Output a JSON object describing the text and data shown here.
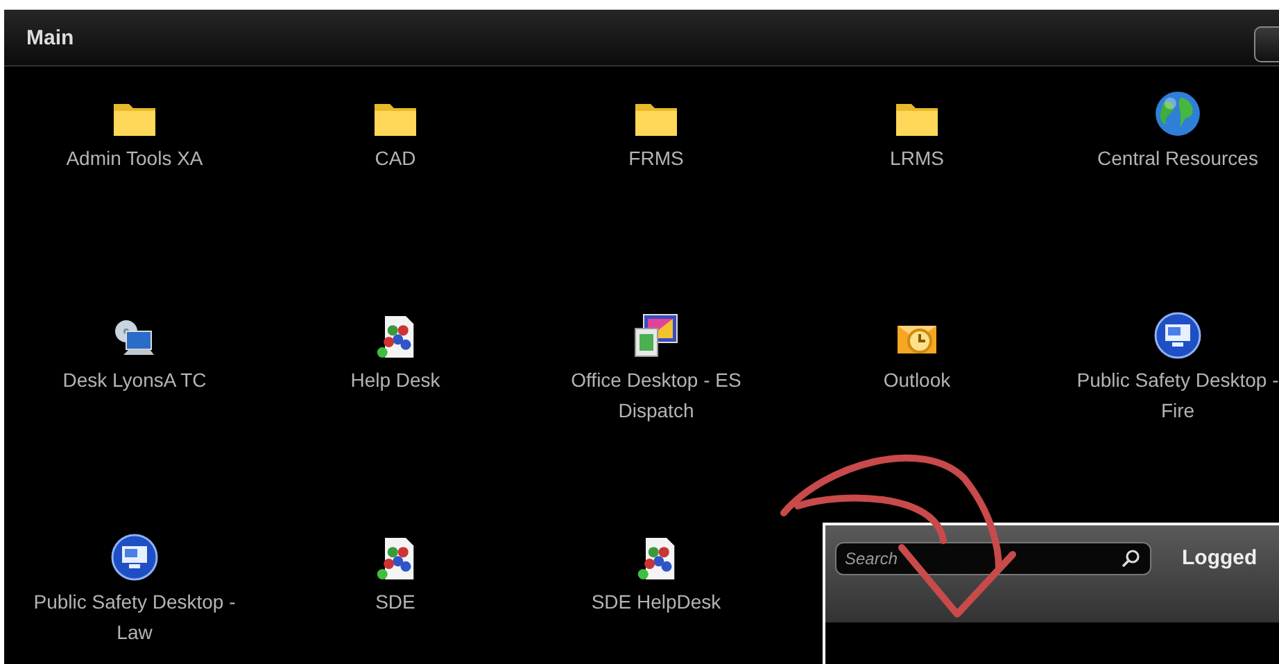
{
  "panel": {
    "title": "Main"
  },
  "items": [
    {
      "label": "Admin Tools XA",
      "kind": "folder"
    },
    {
      "label": "CAD",
      "kind": "folder"
    },
    {
      "label": "FRMS",
      "kind": "folder"
    },
    {
      "label": "LRMS",
      "kind": "folder"
    },
    {
      "label": "Central Resources",
      "kind": "globe"
    },
    {
      "label": "Desk LyonsA TC",
      "kind": "computer"
    },
    {
      "label": "Help Desk",
      "kind": "document"
    },
    {
      "label": "Office Desktop - ES Dispatch",
      "kind": "office"
    },
    {
      "label": "Outlook",
      "kind": "mail"
    },
    {
      "label": "Public Safety Desktop - Fire",
      "kind": "remote"
    },
    {
      "label": "Public Safety Desktop - Law",
      "kind": "remote"
    },
    {
      "label": "SDE",
      "kind": "document"
    },
    {
      "label": "SDE HelpDesk",
      "kind": "document"
    }
  ],
  "inset": {
    "search": {
      "placeholder": "Search"
    },
    "status": "Logged"
  }
}
